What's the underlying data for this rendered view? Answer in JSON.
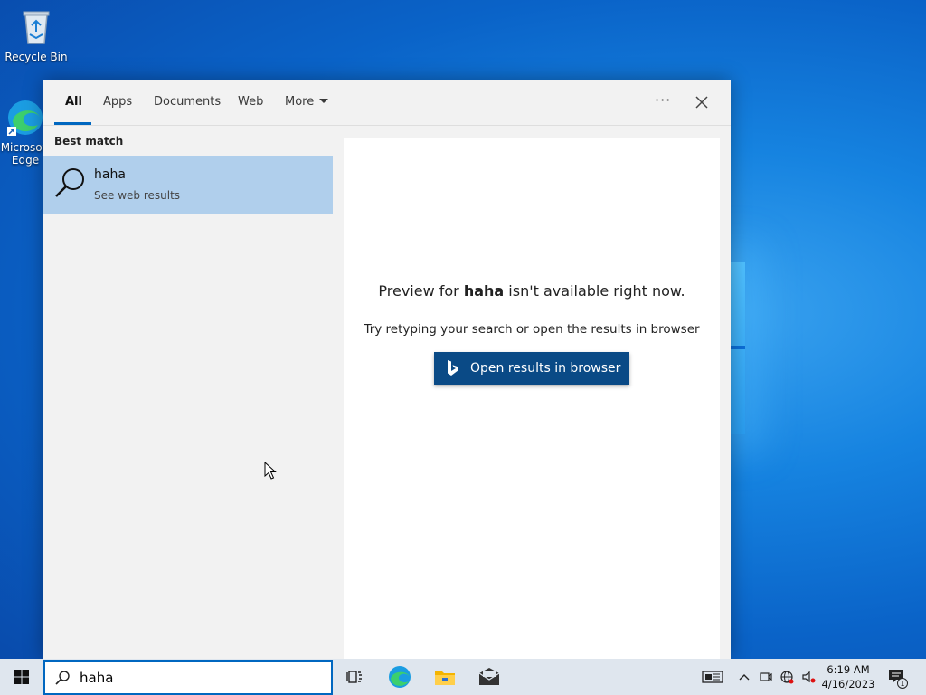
{
  "desktop": {
    "recycle_bin_label": "Recycle Bin",
    "edge_label": "Microsoft Edge"
  },
  "search_panel": {
    "tabs": [
      {
        "label": "All"
      },
      {
        "label": "Apps"
      },
      {
        "label": "Documents"
      },
      {
        "label": "Web"
      },
      {
        "label": "More"
      }
    ],
    "options_label": "···",
    "best_match_label": "Best match",
    "result": {
      "title": "haha",
      "subtitle": "See web results"
    },
    "preview": {
      "headline_pre": "Preview for ",
      "headline_query": "haha",
      "headline_post": " isn't available right now.",
      "hint": "Try retyping your search or open the results in browser",
      "button_label": "Open results in browser"
    }
  },
  "taskbar": {
    "search_value": "haha",
    "clock_time": "6:19 AM",
    "clock_date": "4/16/2023",
    "notification_count": "1"
  },
  "colors": {
    "accent": "#0067c0",
    "selected_result": "#b0cfec",
    "open_button": "#0a4a86"
  }
}
